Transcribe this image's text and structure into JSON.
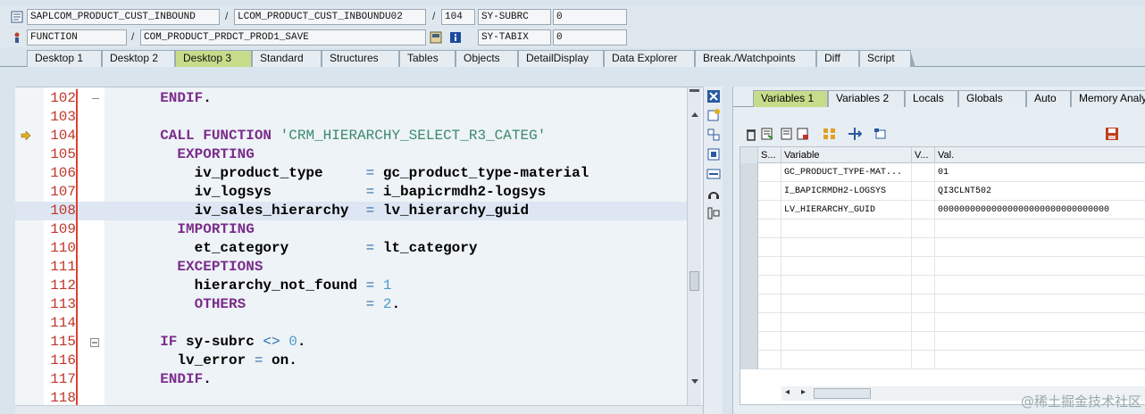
{
  "header": {
    "row1": {
      "program": "SAPLCOM_PRODUCT_CUST_INBOUND",
      "include": "LCOM_PRODUCT_CUST_INBOUNDU02",
      "line": "104",
      "sysvar": "SY-SUBRC",
      "sysval": "0"
    },
    "row2": {
      "type": "FUNCTION",
      "name": "COM_PRODUCT_PRDCT_PROD1_SAVE",
      "sysvar": "SY-TABIX",
      "sysval": "0"
    },
    "slash": "/"
  },
  "tabs": [
    "Desktop 1",
    "Desktop 2",
    "Desktop 3",
    "Standard",
    "Structures",
    "Tables",
    "Objects",
    "DetailDisplay",
    "Data Explorer",
    "Break./Watchpoints",
    "Diff",
    "Script"
  ],
  "active_tab": "Desktop 3",
  "code": {
    "lines": [
      {
        "num": "102",
        "text": "  ENDIF."
      },
      {
        "num": "103",
        "text": ""
      },
      {
        "num": "104",
        "text": "  CALL FUNCTION 'CRM_HIERARCHY_SELECT_R3_CATEG'"
      },
      {
        "num": "105",
        "text": "    EXPORTING"
      },
      {
        "num": "106",
        "text": "      iv_product_type     = gc_product_type-material"
      },
      {
        "num": "107",
        "text": "      iv_logsys           = i_bapicrmdh2-logsys"
      },
      {
        "num": "108",
        "text": "      iv_sales_hierarchy  = lv_hierarchy_guid"
      },
      {
        "num": "109",
        "text": "    IMPORTING"
      },
      {
        "num": "110",
        "text": "      et_category         = lt_category"
      },
      {
        "num": "111",
        "text": "    EXCEPTIONS"
      },
      {
        "num": "112",
        "text": "      hierarchy_not_found = 1"
      },
      {
        "num": "113",
        "text": "      OTHERS              = 2."
      },
      {
        "num": "114",
        "text": ""
      },
      {
        "num": "115",
        "text": "  IF sy-subrc <> 0."
      },
      {
        "num": "116",
        "text": "    lv_error = on."
      },
      {
        "num": "117",
        "text": "  ENDIF."
      },
      {
        "num": "118",
        "text": ""
      }
    ],
    "current_line": "104",
    "highlight_line": "108"
  },
  "variables": {
    "tabs": [
      "Variables 1",
      "Variables 2",
      "Locals",
      "Globals",
      "Auto",
      "Memory Analy"
    ],
    "active_tab": "Variables 1",
    "columns": [
      "S...",
      "Variable",
      "V...",
      "Val."
    ],
    "rows": [
      {
        "variable": "GC_PRODUCT_TYPE-MAT...",
        "value": "01"
      },
      {
        "variable": "I_BAPICRMDH2-LOGSYS",
        "value": "QI3CLNT502"
      },
      {
        "variable": "LV_HIERARCHY_GUID",
        "value": "00000000000000000000000000000000"
      }
    ]
  },
  "watermark": "@稀土掘金技术社区",
  "colors": {
    "accent_tab": "#c7dc8a",
    "line_number": "#c0362c",
    "keyword": "#7a2d8a",
    "string": "#3a8a6a",
    "number": "#4a9acb"
  }
}
